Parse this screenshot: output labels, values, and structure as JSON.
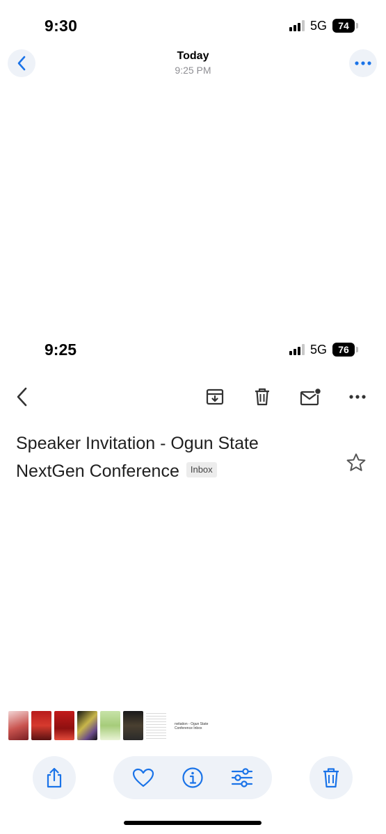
{
  "status_bar": {
    "time": "9:30",
    "network": "5G",
    "battery": "74"
  },
  "viewer": {
    "title": "Today",
    "subtitle": "9:25 PM"
  },
  "screenshot": {
    "status_bar": {
      "time": "9:25",
      "network": "5G",
      "battery": "76"
    },
    "toolbar_icons": [
      "back-icon",
      "archive-icon",
      "trash-icon",
      "mark-unread-icon",
      "more-icon"
    ],
    "subject_line1": "Speaker Invitation - Ogun State",
    "subject_line2": "NextGen Conference",
    "label_chip": "Inbox"
  },
  "thumbnail_preview": {
    "line1": "nvitation - Ogun State",
    "line2": "Conference",
    "chip": "Inbox"
  },
  "bottom_bar_icons": [
    "share-icon",
    "favorite-icon",
    "info-icon",
    "adjust-icon",
    "delete-icon"
  ],
  "colors": {
    "accent": "#1a73e8",
    "button_bg": "#eef2f8"
  }
}
